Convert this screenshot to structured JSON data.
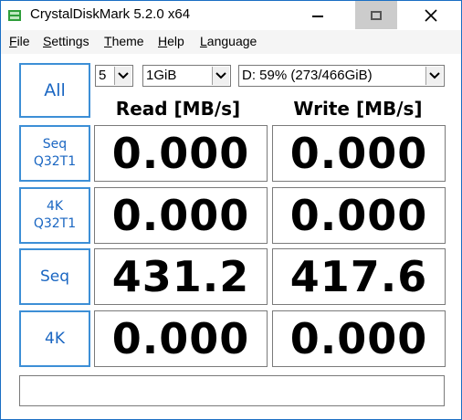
{
  "window": {
    "title": "CrystalDiskMark 5.2.0 x64",
    "accent_color": "#1a6fc4",
    "icon": "disk-app-icon"
  },
  "menu": {
    "items": [
      {
        "label": "File"
      },
      {
        "label": "Settings"
      },
      {
        "label": "Theme"
      },
      {
        "label": "Help"
      },
      {
        "label": "Language"
      }
    ]
  },
  "controls": {
    "all_button": "All",
    "runs": "5",
    "size": "1GiB",
    "drive": "D: 59% (273/466GiB)"
  },
  "headers": {
    "read": "Read [MB/s]",
    "write": "Write [MB/s]"
  },
  "tests": [
    {
      "label_line1": "Seq",
      "label_line2": "Q32T1",
      "read": "0.000",
      "write": "0.000"
    },
    {
      "label_line1": "4K",
      "label_line2": "Q32T1",
      "read": "0.000",
      "write": "0.000"
    },
    {
      "label_line1": "Seq",
      "label_line2": "",
      "read": "431.2",
      "write": "417.6"
    },
    {
      "label_line1": "4K",
      "label_line2": "",
      "read": "0.000",
      "write": "0.000"
    }
  ],
  "comment": ""
}
